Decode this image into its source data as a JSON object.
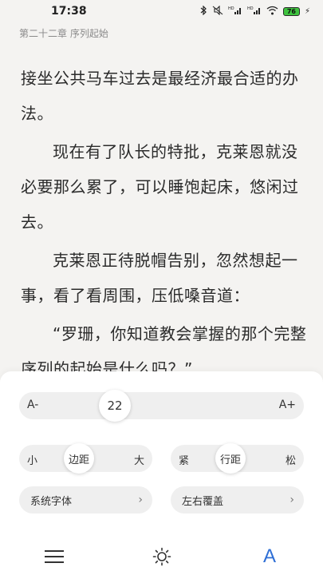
{
  "status_bar": {
    "time": "17:38",
    "icons": [
      "bluetooth-icon",
      "mute-icon",
      "signal-hd-icon",
      "signal-hd-icon",
      "wifi-icon"
    ],
    "battery": "76"
  },
  "chapter": {
    "title": "第二十二章 序列起始"
  },
  "reader": {
    "paragraphs": [
      "接坐公共马车过去是最经济最合适的办法。",
      "现在有了队长的特批，克莱恩就没必要那么累了，可以睡饱起床，悠闲过去。",
      "克莱恩正待脱帽告别，忽然想起一事，看了看周围，压低嗓音道：",
      "“罗珊，你知道教会掌握的那个完整序列的起始是什么吗？”"
    ]
  },
  "settings": {
    "font_size": {
      "decrease_label": "A-",
      "value": "22",
      "increase_label": "A+"
    },
    "margin": {
      "min_label": "小",
      "knob_label": "边距",
      "max_label": "大"
    },
    "line_spacing": {
      "min_label": "紧",
      "knob_label": "行距",
      "max_label": "松"
    },
    "system_font_label": "系统字体",
    "page_turn_label": "左右覆盖",
    "chevron": "›"
  },
  "tabbar": {
    "font_tab_label": "A"
  },
  "colors": {
    "background": "#f4f3f1",
    "panel": "#ffffff",
    "accent": "#2f6fd6",
    "battery": "#3ec23e"
  }
}
